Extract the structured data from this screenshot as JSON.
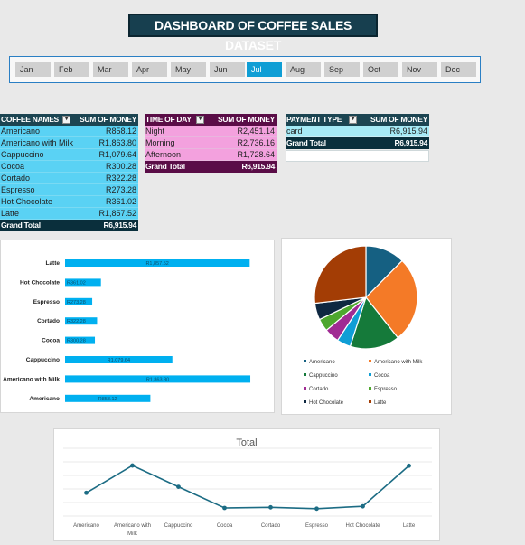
{
  "title": "DASHBOARD OF COFFEE SALES DATASET",
  "months": [
    "Jan",
    "Feb",
    "Mar",
    "Apr",
    "May",
    "Jun",
    "Jul",
    "Aug",
    "Sep",
    "Oct",
    "Nov",
    "Dec"
  ],
  "active_month": "Jul",
  "colors": {
    "title_bg": "#173f4f",
    "slicer_active": "#0f9ed5",
    "coffee_header": "#1c4552",
    "coffee_row": "#5ad2f4",
    "coffee_total": "#0a2f3c",
    "time_header": "#5a0d47",
    "time_row": "#f3a1de",
    "time_total": "#5a0d47",
    "pay_header": "#1c4552",
    "pay_row": "#a6eaf6",
    "pay_total": "#0a2f3c",
    "bar": "#00b0f0",
    "line": "#1c6c84"
  },
  "coffee_table": {
    "col1": "COFFEE NAMES",
    "col2": "SUM OF MONEY",
    "rows": [
      {
        "name": "Americano",
        "value": "R858.12"
      },
      {
        "name": "Americano with Milk",
        "value": "R1,863.80"
      },
      {
        "name": "Cappuccino",
        "value": "R1,079.64"
      },
      {
        "name": "Cocoa",
        "value": "R300.28"
      },
      {
        "name": "Cortado",
        "value": "R322.28"
      },
      {
        "name": "Espresso",
        "value": "R273.28"
      },
      {
        "name": "Hot Chocolate",
        "value": "R361.02"
      },
      {
        "name": "Latte",
        "value": "R1,857.52"
      }
    ],
    "total_label": "Grand Total",
    "total_value": "R6,915.94"
  },
  "time_table": {
    "col1": "TIME OF DAY",
    "col2": "SUM OF MONEY",
    "rows": [
      {
        "name": "Night",
        "value": "R2,451.14"
      },
      {
        "name": "Morning",
        "value": "R2,736.16"
      },
      {
        "name": "Afternoon",
        "value": "R1,728.64"
      }
    ],
    "total_label": "Grand Total",
    "total_value": "R6,915.94"
  },
  "payment_table": {
    "col1": "PAYMENT TYPE",
    "col2": "SUM OF MONEY",
    "rows": [
      {
        "name": "card",
        "value": "R6,915.94"
      }
    ],
    "total_label": "Grand Total",
    "total_value": "R6,915.94"
  },
  "chart_data": [
    {
      "type": "bar",
      "orientation": "horizontal",
      "categories": [
        "Latte",
        "Hot Chocolate",
        "Espresso",
        "Cortado",
        "Cocoa",
        "Cappuccino",
        "Americano with Milk",
        "Americano"
      ],
      "values": [
        1857.52,
        361.02,
        273.28,
        322.28,
        300.28,
        1079.64,
        1863.8,
        858.12
      ],
      "data_labels": [
        "R1,857.52",
        "R361.02",
        "R273.28",
        "R322.28",
        "R300.28",
        "R1,079.64",
        "R1,863.80",
        "R858.12"
      ],
      "color": "#00b0f0"
    },
    {
      "type": "pie",
      "labels": [
        "Americano",
        "Americano with Milk",
        "Cappuccino",
        "Cocoa",
        "Cortado",
        "Espresso",
        "Hot Chocolate",
        "Latte"
      ],
      "values": [
        858.12,
        1863.8,
        1079.64,
        300.28,
        322.28,
        273.28,
        361.02,
        1857.52
      ],
      "colors": [
        "#156082",
        "#f47a27",
        "#157a3a",
        "#0f9ed5",
        "#a02b93",
        "#4ea72e",
        "#0e2841",
        "#a33d05"
      ],
      "legend": "bottom"
    },
    {
      "type": "line",
      "title": "Total",
      "categories": [
        "Americano",
        "Americano with Milk",
        "Cappuccino",
        "Cocoa",
        "Cortado",
        "Espresso",
        "Hot Chocolate",
        "Latte"
      ],
      "values": [
        858.12,
        1863.8,
        1079.64,
        300.28,
        322.28,
        273.28,
        361.02,
        1857.52
      ],
      "ylim": [
        0,
        2500
      ],
      "grid": true,
      "color": "#1c6c84"
    }
  ]
}
